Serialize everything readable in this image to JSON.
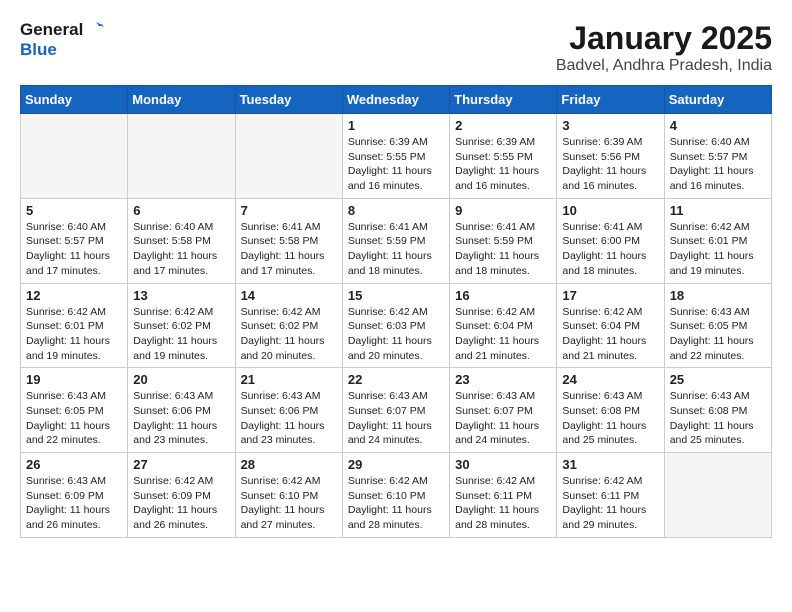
{
  "header": {
    "logo_general": "General",
    "logo_blue": "Blue",
    "month": "January 2025",
    "location": "Badvel, Andhra Pradesh, India"
  },
  "weekdays": [
    "Sunday",
    "Monday",
    "Tuesday",
    "Wednesday",
    "Thursday",
    "Friday",
    "Saturday"
  ],
  "weeks": [
    [
      {
        "day": "",
        "info": ""
      },
      {
        "day": "",
        "info": ""
      },
      {
        "day": "",
        "info": ""
      },
      {
        "day": "1",
        "info": "Sunrise: 6:39 AM\nSunset: 5:55 PM\nDaylight: 11 hours and 16 minutes."
      },
      {
        "day": "2",
        "info": "Sunrise: 6:39 AM\nSunset: 5:55 PM\nDaylight: 11 hours and 16 minutes."
      },
      {
        "day": "3",
        "info": "Sunrise: 6:39 AM\nSunset: 5:56 PM\nDaylight: 11 hours and 16 minutes."
      },
      {
        "day": "4",
        "info": "Sunrise: 6:40 AM\nSunset: 5:57 PM\nDaylight: 11 hours and 16 minutes."
      }
    ],
    [
      {
        "day": "5",
        "info": "Sunrise: 6:40 AM\nSunset: 5:57 PM\nDaylight: 11 hours and 17 minutes."
      },
      {
        "day": "6",
        "info": "Sunrise: 6:40 AM\nSunset: 5:58 PM\nDaylight: 11 hours and 17 minutes."
      },
      {
        "day": "7",
        "info": "Sunrise: 6:41 AM\nSunset: 5:58 PM\nDaylight: 11 hours and 17 minutes."
      },
      {
        "day": "8",
        "info": "Sunrise: 6:41 AM\nSunset: 5:59 PM\nDaylight: 11 hours and 18 minutes."
      },
      {
        "day": "9",
        "info": "Sunrise: 6:41 AM\nSunset: 5:59 PM\nDaylight: 11 hours and 18 minutes."
      },
      {
        "day": "10",
        "info": "Sunrise: 6:41 AM\nSunset: 6:00 PM\nDaylight: 11 hours and 18 minutes."
      },
      {
        "day": "11",
        "info": "Sunrise: 6:42 AM\nSunset: 6:01 PM\nDaylight: 11 hours and 19 minutes."
      }
    ],
    [
      {
        "day": "12",
        "info": "Sunrise: 6:42 AM\nSunset: 6:01 PM\nDaylight: 11 hours and 19 minutes."
      },
      {
        "day": "13",
        "info": "Sunrise: 6:42 AM\nSunset: 6:02 PM\nDaylight: 11 hours and 19 minutes."
      },
      {
        "day": "14",
        "info": "Sunrise: 6:42 AM\nSunset: 6:02 PM\nDaylight: 11 hours and 20 minutes."
      },
      {
        "day": "15",
        "info": "Sunrise: 6:42 AM\nSunset: 6:03 PM\nDaylight: 11 hours and 20 minutes."
      },
      {
        "day": "16",
        "info": "Sunrise: 6:42 AM\nSunset: 6:04 PM\nDaylight: 11 hours and 21 minutes."
      },
      {
        "day": "17",
        "info": "Sunrise: 6:42 AM\nSunset: 6:04 PM\nDaylight: 11 hours and 21 minutes."
      },
      {
        "day": "18",
        "info": "Sunrise: 6:43 AM\nSunset: 6:05 PM\nDaylight: 11 hours and 22 minutes."
      }
    ],
    [
      {
        "day": "19",
        "info": "Sunrise: 6:43 AM\nSunset: 6:05 PM\nDaylight: 11 hours and 22 minutes."
      },
      {
        "day": "20",
        "info": "Sunrise: 6:43 AM\nSunset: 6:06 PM\nDaylight: 11 hours and 23 minutes."
      },
      {
        "day": "21",
        "info": "Sunrise: 6:43 AM\nSunset: 6:06 PM\nDaylight: 11 hours and 23 minutes."
      },
      {
        "day": "22",
        "info": "Sunrise: 6:43 AM\nSunset: 6:07 PM\nDaylight: 11 hours and 24 minutes."
      },
      {
        "day": "23",
        "info": "Sunrise: 6:43 AM\nSunset: 6:07 PM\nDaylight: 11 hours and 24 minutes."
      },
      {
        "day": "24",
        "info": "Sunrise: 6:43 AM\nSunset: 6:08 PM\nDaylight: 11 hours and 25 minutes."
      },
      {
        "day": "25",
        "info": "Sunrise: 6:43 AM\nSunset: 6:08 PM\nDaylight: 11 hours and 25 minutes."
      }
    ],
    [
      {
        "day": "26",
        "info": "Sunrise: 6:43 AM\nSunset: 6:09 PM\nDaylight: 11 hours and 26 minutes."
      },
      {
        "day": "27",
        "info": "Sunrise: 6:42 AM\nSunset: 6:09 PM\nDaylight: 11 hours and 26 minutes."
      },
      {
        "day": "28",
        "info": "Sunrise: 6:42 AM\nSunset: 6:10 PM\nDaylight: 11 hours and 27 minutes."
      },
      {
        "day": "29",
        "info": "Sunrise: 6:42 AM\nSunset: 6:10 PM\nDaylight: 11 hours and 28 minutes."
      },
      {
        "day": "30",
        "info": "Sunrise: 6:42 AM\nSunset: 6:11 PM\nDaylight: 11 hours and 28 minutes."
      },
      {
        "day": "31",
        "info": "Sunrise: 6:42 AM\nSunset: 6:11 PM\nDaylight: 11 hours and 29 minutes."
      },
      {
        "day": "",
        "info": ""
      }
    ]
  ]
}
